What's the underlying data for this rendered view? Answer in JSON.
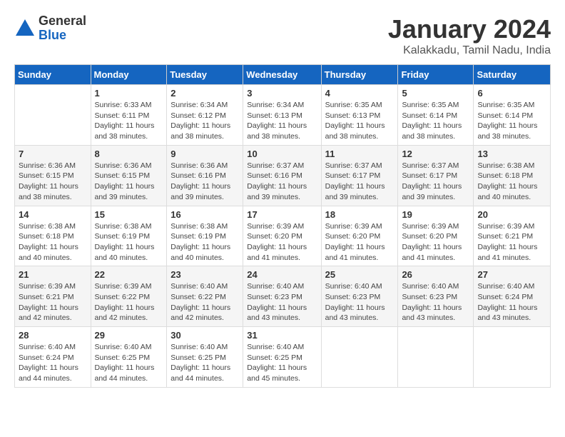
{
  "header": {
    "logo_general": "General",
    "logo_blue": "Blue",
    "main_title": "January 2024",
    "subtitle": "Kalakkadu, Tamil Nadu, India"
  },
  "calendar": {
    "days_of_week": [
      "Sunday",
      "Monday",
      "Tuesday",
      "Wednesday",
      "Thursday",
      "Friday",
      "Saturday"
    ],
    "weeks": [
      [
        {
          "day": "",
          "info": ""
        },
        {
          "day": "1",
          "info": "Sunrise: 6:33 AM\nSunset: 6:11 PM\nDaylight: 11 hours\nand 38 minutes."
        },
        {
          "day": "2",
          "info": "Sunrise: 6:34 AM\nSunset: 6:12 PM\nDaylight: 11 hours\nand 38 minutes."
        },
        {
          "day": "3",
          "info": "Sunrise: 6:34 AM\nSunset: 6:13 PM\nDaylight: 11 hours\nand 38 minutes."
        },
        {
          "day": "4",
          "info": "Sunrise: 6:35 AM\nSunset: 6:13 PM\nDaylight: 11 hours\nand 38 minutes."
        },
        {
          "day": "5",
          "info": "Sunrise: 6:35 AM\nSunset: 6:14 PM\nDaylight: 11 hours\nand 38 minutes."
        },
        {
          "day": "6",
          "info": "Sunrise: 6:35 AM\nSunset: 6:14 PM\nDaylight: 11 hours\nand 38 minutes."
        }
      ],
      [
        {
          "day": "7",
          "info": "Sunrise: 6:36 AM\nSunset: 6:15 PM\nDaylight: 11 hours\nand 38 minutes."
        },
        {
          "day": "8",
          "info": "Sunrise: 6:36 AM\nSunset: 6:15 PM\nDaylight: 11 hours\nand 39 minutes."
        },
        {
          "day": "9",
          "info": "Sunrise: 6:36 AM\nSunset: 6:16 PM\nDaylight: 11 hours\nand 39 minutes."
        },
        {
          "day": "10",
          "info": "Sunrise: 6:37 AM\nSunset: 6:16 PM\nDaylight: 11 hours\nand 39 minutes."
        },
        {
          "day": "11",
          "info": "Sunrise: 6:37 AM\nSunset: 6:17 PM\nDaylight: 11 hours\nand 39 minutes."
        },
        {
          "day": "12",
          "info": "Sunrise: 6:37 AM\nSunset: 6:17 PM\nDaylight: 11 hours\nand 39 minutes."
        },
        {
          "day": "13",
          "info": "Sunrise: 6:38 AM\nSunset: 6:18 PM\nDaylight: 11 hours\nand 40 minutes."
        }
      ],
      [
        {
          "day": "14",
          "info": "Sunrise: 6:38 AM\nSunset: 6:18 PM\nDaylight: 11 hours\nand 40 minutes."
        },
        {
          "day": "15",
          "info": "Sunrise: 6:38 AM\nSunset: 6:19 PM\nDaylight: 11 hours\nand 40 minutes."
        },
        {
          "day": "16",
          "info": "Sunrise: 6:38 AM\nSunset: 6:19 PM\nDaylight: 11 hours\nand 40 minutes."
        },
        {
          "day": "17",
          "info": "Sunrise: 6:39 AM\nSunset: 6:20 PM\nDaylight: 11 hours\nand 41 minutes."
        },
        {
          "day": "18",
          "info": "Sunrise: 6:39 AM\nSunset: 6:20 PM\nDaylight: 11 hours\nand 41 minutes."
        },
        {
          "day": "19",
          "info": "Sunrise: 6:39 AM\nSunset: 6:20 PM\nDaylight: 11 hours\nand 41 minutes."
        },
        {
          "day": "20",
          "info": "Sunrise: 6:39 AM\nSunset: 6:21 PM\nDaylight: 11 hours\nand 41 minutes."
        }
      ],
      [
        {
          "day": "21",
          "info": "Sunrise: 6:39 AM\nSunset: 6:21 PM\nDaylight: 11 hours\nand 42 minutes."
        },
        {
          "day": "22",
          "info": "Sunrise: 6:39 AM\nSunset: 6:22 PM\nDaylight: 11 hours\nand 42 minutes."
        },
        {
          "day": "23",
          "info": "Sunrise: 6:40 AM\nSunset: 6:22 PM\nDaylight: 11 hours\nand 42 minutes."
        },
        {
          "day": "24",
          "info": "Sunrise: 6:40 AM\nSunset: 6:23 PM\nDaylight: 11 hours\nand 43 minutes."
        },
        {
          "day": "25",
          "info": "Sunrise: 6:40 AM\nSunset: 6:23 PM\nDaylight: 11 hours\nand 43 minutes."
        },
        {
          "day": "26",
          "info": "Sunrise: 6:40 AM\nSunset: 6:23 PM\nDaylight: 11 hours\nand 43 minutes."
        },
        {
          "day": "27",
          "info": "Sunrise: 6:40 AM\nSunset: 6:24 PM\nDaylight: 11 hours\nand 43 minutes."
        }
      ],
      [
        {
          "day": "28",
          "info": "Sunrise: 6:40 AM\nSunset: 6:24 PM\nDaylight: 11 hours\nand 44 minutes."
        },
        {
          "day": "29",
          "info": "Sunrise: 6:40 AM\nSunset: 6:25 PM\nDaylight: 11 hours\nand 44 minutes."
        },
        {
          "day": "30",
          "info": "Sunrise: 6:40 AM\nSunset: 6:25 PM\nDaylight: 11 hours\nand 44 minutes."
        },
        {
          "day": "31",
          "info": "Sunrise: 6:40 AM\nSunset: 6:25 PM\nDaylight: 11 hours\nand 45 minutes."
        },
        {
          "day": "",
          "info": ""
        },
        {
          "day": "",
          "info": ""
        },
        {
          "day": "",
          "info": ""
        }
      ]
    ]
  }
}
